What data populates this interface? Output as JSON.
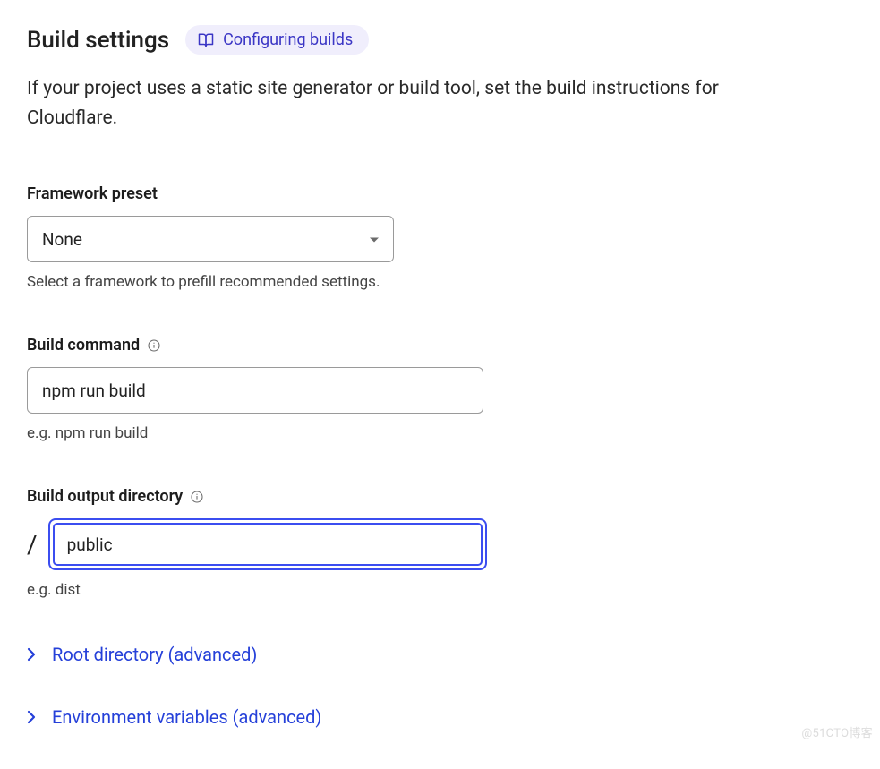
{
  "header": {
    "title": "Build settings",
    "docs_link": "Configuring builds"
  },
  "description": "If your project uses a static site generator or build tool, set the build instructions for Cloudflare.",
  "framework_preset": {
    "label": "Framework preset",
    "value": "None",
    "helper": "Select a framework to prefill recommended settings."
  },
  "build_command": {
    "label": "Build command",
    "value": "npm run build",
    "helper": "e.g. npm run build"
  },
  "output_dir": {
    "label": "Build output directory",
    "prefix": "/",
    "value": "public",
    "helper": "e.g. dist"
  },
  "advanced": {
    "root_directory": "Root directory (advanced)",
    "env_vars": "Environment variables (advanced)"
  },
  "watermark": "@51CTO博客"
}
